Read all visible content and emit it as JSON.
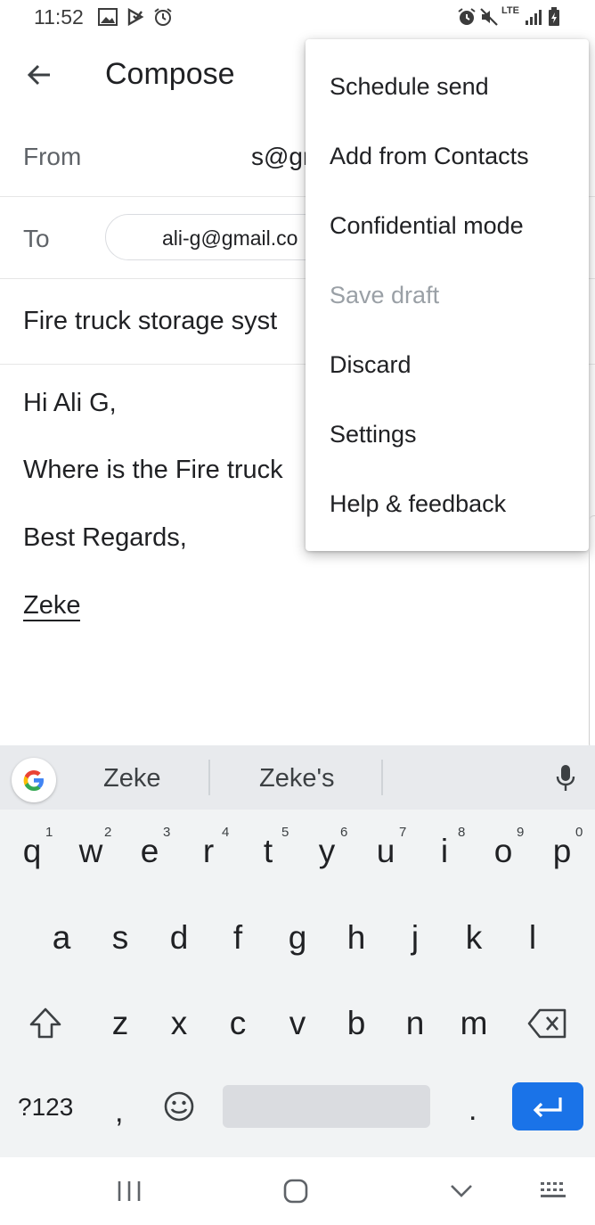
{
  "status_bar": {
    "time": "11:52",
    "network": "LTE"
  },
  "header": {
    "title": "Compose"
  },
  "fields": {
    "from_label": "From",
    "from_value": "s@gr",
    "to_label": "To",
    "to_chip": "ali-g@gmail.co",
    "subject": "Fire truck storage syst"
  },
  "body": {
    "line1": "Hi Ali G,",
    "line2": "Where is the Fire truck",
    "line3": "Best Regards,",
    "signature": "Zeke"
  },
  "menu": {
    "items": [
      {
        "label": "Schedule send"
      },
      {
        "label": "Add from Contacts"
      },
      {
        "label": "Confidential mode"
      },
      {
        "label": "Save draft",
        "disabled": true
      },
      {
        "label": "Discard"
      },
      {
        "label": "Settings"
      },
      {
        "label": "Help & feedback"
      }
    ]
  },
  "keyboard": {
    "suggestions": [
      "Zeke",
      "Zeke's"
    ],
    "row1": [
      "q",
      "w",
      "e",
      "r",
      "t",
      "y",
      "u",
      "i",
      "o",
      "p"
    ],
    "row1_hints": [
      "1",
      "2",
      "3",
      "4",
      "5",
      "6",
      "7",
      "8",
      "9",
      "0"
    ],
    "row2": [
      "a",
      "s",
      "d",
      "f",
      "g",
      "h",
      "j",
      "k",
      "l"
    ],
    "row3": [
      "z",
      "x",
      "c",
      "v",
      "b",
      "n",
      "m"
    ],
    "symbols_label": "?123",
    "comma": ",",
    "period": ".",
    "accent_color": "#1a73e8"
  },
  "icons": {
    "back": "arrow-left-icon",
    "mic": "microphone-icon",
    "shift": "shift-icon",
    "backspace": "backspace-icon",
    "emoji": "emoji-icon",
    "enter": "enter-icon"
  }
}
